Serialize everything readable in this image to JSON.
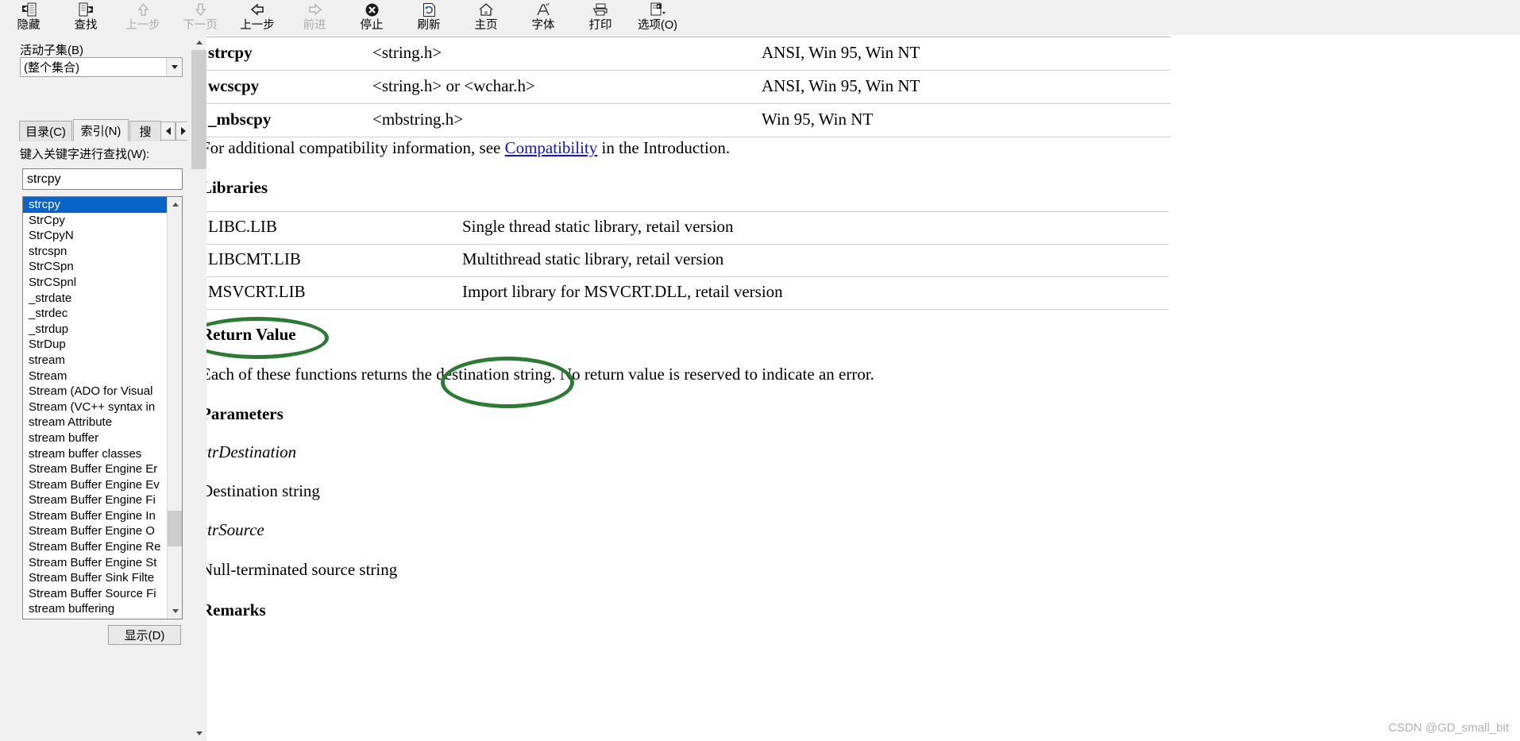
{
  "toolbar": {
    "buttons": [
      {
        "label": "隐藏",
        "icon": "hide-pane-icon",
        "disabled": false
      },
      {
        "label": "查找",
        "icon": "locate-icon",
        "disabled": false
      },
      {
        "label": "上一步",
        "icon": "arrow-up-icon",
        "disabled": true
      },
      {
        "label": "下一页",
        "icon": "arrow-down-icon",
        "disabled": true
      },
      {
        "label": "上一步",
        "icon": "arrow-back-icon",
        "disabled": false
      },
      {
        "label": "前进",
        "icon": "arrow-forward-icon",
        "disabled": true
      },
      {
        "label": "停止",
        "icon": "stop-icon",
        "disabled": false
      },
      {
        "label": "刷新",
        "icon": "refresh-icon",
        "disabled": false
      },
      {
        "label": "主页",
        "icon": "home-icon",
        "disabled": false
      },
      {
        "label": "字体",
        "icon": "font-icon",
        "disabled": false
      },
      {
        "label": "打印",
        "icon": "print-icon",
        "disabled": false
      },
      {
        "label": "选项(O)",
        "icon": "options-icon",
        "disabled": false
      }
    ]
  },
  "sidebar": {
    "subset_label": "活动子集(B)",
    "subset_value": "(整个集合)",
    "tabs": [
      {
        "label": "目录(C)",
        "active": false
      },
      {
        "label": "索引(N)",
        "active": true
      },
      {
        "label": "搜",
        "active": false
      }
    ],
    "keyword_label": "键入关键字进行查找(W):",
    "keyword_value": "strcpy",
    "show_button": "显示(D)",
    "list_items": [
      "strcpy",
      "StrCpy",
      "StrCpyN",
      "strcspn",
      "StrCSpn",
      "StrCSpnl",
      "_strdate",
      "_strdec",
      "_strdup",
      "StrDup",
      "stream",
      "Stream",
      "Stream (ADO for Visual",
      "Stream (VC++ syntax in",
      "stream Attribute",
      "stream buffer",
      "stream buffer classes",
      "Stream Buffer Engine Er",
      "Stream Buffer Engine Ev",
      "Stream Buffer Engine Fi",
      "Stream Buffer Engine In",
      "Stream Buffer Engine O",
      "Stream Buffer Engine Re",
      "Stream Buffer Engine St",
      "Stream Buffer Sink Filte",
      "Stream Buffer Source Fi",
      "stream buffering"
    ],
    "selected_index": 0
  },
  "content": {
    "compat_table": {
      "rows": [
        {
          "name": "strcpy",
          "header": "<string.h>",
          "compat": "ANSI, Win 95, Win NT"
        },
        {
          "name": "wcscpy",
          "header": "<string.h> or <wchar.h>",
          "compat": "ANSI, Win 95, Win NT"
        },
        {
          "name": "_mbscpy",
          "header": "<mbstring.h>",
          "compat": "Win 95, Win NT"
        }
      ]
    },
    "compat_note_before": "For additional compatibility information, see ",
    "compat_note_link": "Compatibility",
    "compat_note_after": " in the Introduction.",
    "libraries_heading": "Libraries",
    "lib_table": {
      "rows": [
        {
          "name": "LIBC.LIB",
          "desc": "Single thread static library, retail version"
        },
        {
          "name": "LIBCMT.LIB",
          "desc": "Multithread static library, retail version"
        },
        {
          "name": "MSVCRT.LIB",
          "desc": "Import library for MSVCRT.DLL, retail version"
        }
      ]
    },
    "return_value_heading": "Return Value",
    "return_value_text_a": "Each of these functions returns the ",
    "return_value_text_b": "destination string",
    "return_value_text_c": ". No return value is reserved to indicate an error.",
    "parameters_heading": "Parameters",
    "param1_name": "strDestination",
    "param1_desc": "Destination string",
    "param2_name": "strSource",
    "param2_desc": "Null-terminated source string",
    "remarks_heading": "Remarks"
  },
  "annotations": {
    "color": "#2d7a34",
    "ellipse1_target": "Return Value",
    "ellipse2_target": "destination string"
  },
  "watermark": "CSDN @GD_small_bit"
}
